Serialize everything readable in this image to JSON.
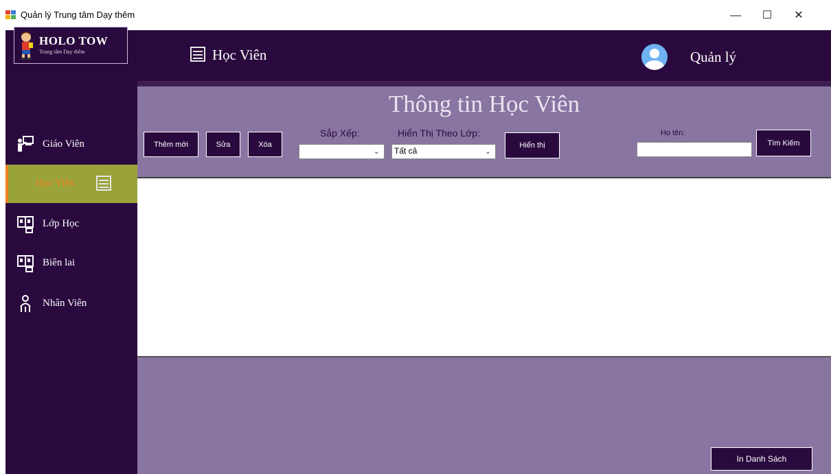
{
  "window": {
    "title": "Quản lý Trung tâm Dạy thêm",
    "controls": {
      "minimize": "—",
      "maximize": "☐",
      "close": "✕"
    }
  },
  "logo": {
    "title": "HOLO TOW",
    "subtitle": "Trung tâm Dạy thêm"
  },
  "sidebar": {
    "items": [
      {
        "label": "Giáo Viên",
        "icon": "teacher-icon",
        "active": false
      },
      {
        "label": "Học Viên",
        "icon": "student-icon",
        "active": true
      },
      {
        "label": "Lớp Học",
        "icon": "classroom-icon",
        "active": false
      },
      {
        "label": "Biên lai",
        "icon": "receipt-icon",
        "active": false
      },
      {
        "label": "Nhân Viên",
        "icon": "staff-icon",
        "active": false
      }
    ]
  },
  "header": {
    "page_title": "Học Viên",
    "user_label": "Quản lý"
  },
  "panel": {
    "title": "Thông tin Học Viên",
    "add_button": "Thêm mới",
    "edit_button": "Sửa",
    "delete_button": "Xóa",
    "sort_label": "Sắp Xếp:",
    "sort_value": "",
    "class_filter_label": "Hiển Thị Theo Lớp:",
    "class_filter_value": "Tất cả",
    "show_button": "Hiển thị",
    "name_label": "Họ tên:",
    "name_value": "",
    "search_button": "Tìm Kiếm"
  },
  "footer": {
    "print_button": "In Danh Sách"
  },
  "colors": {
    "sidebar_bg": "#2a0a3e",
    "panel_bg": "#8975a1",
    "active_item_bg": "#9aa33a",
    "active_item_text": "#f4801f"
  }
}
